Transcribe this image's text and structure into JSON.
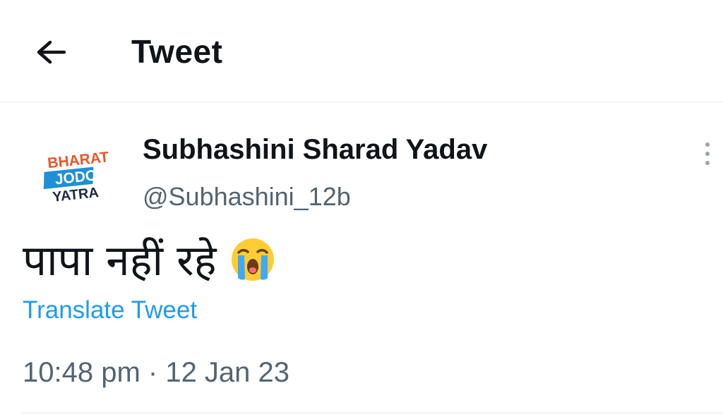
{
  "header": {
    "title": "Tweet",
    "back_icon": "arrow-left-icon"
  },
  "tweet": {
    "avatar": {
      "line1": "BHARAT",
      "line2": "JODO",
      "line3": "YATRA"
    },
    "display_name": "Subhashini Sharad Yadav",
    "handle": "@Subhashini_12b",
    "more_icon": "more-vertical-icon",
    "text": "पापा नहीं रहे",
    "emoji": "loudly-crying-face-icon",
    "translate_label": "Translate Tweet",
    "timestamp": "10:48 pm · 12 Jan 23"
  },
  "colors": {
    "link": "#1d9bf0",
    "secondary_text": "#536471",
    "logo_orange": "#e8562a",
    "logo_blue": "#1f8fd6",
    "logo_dark": "#1f2a44"
  }
}
